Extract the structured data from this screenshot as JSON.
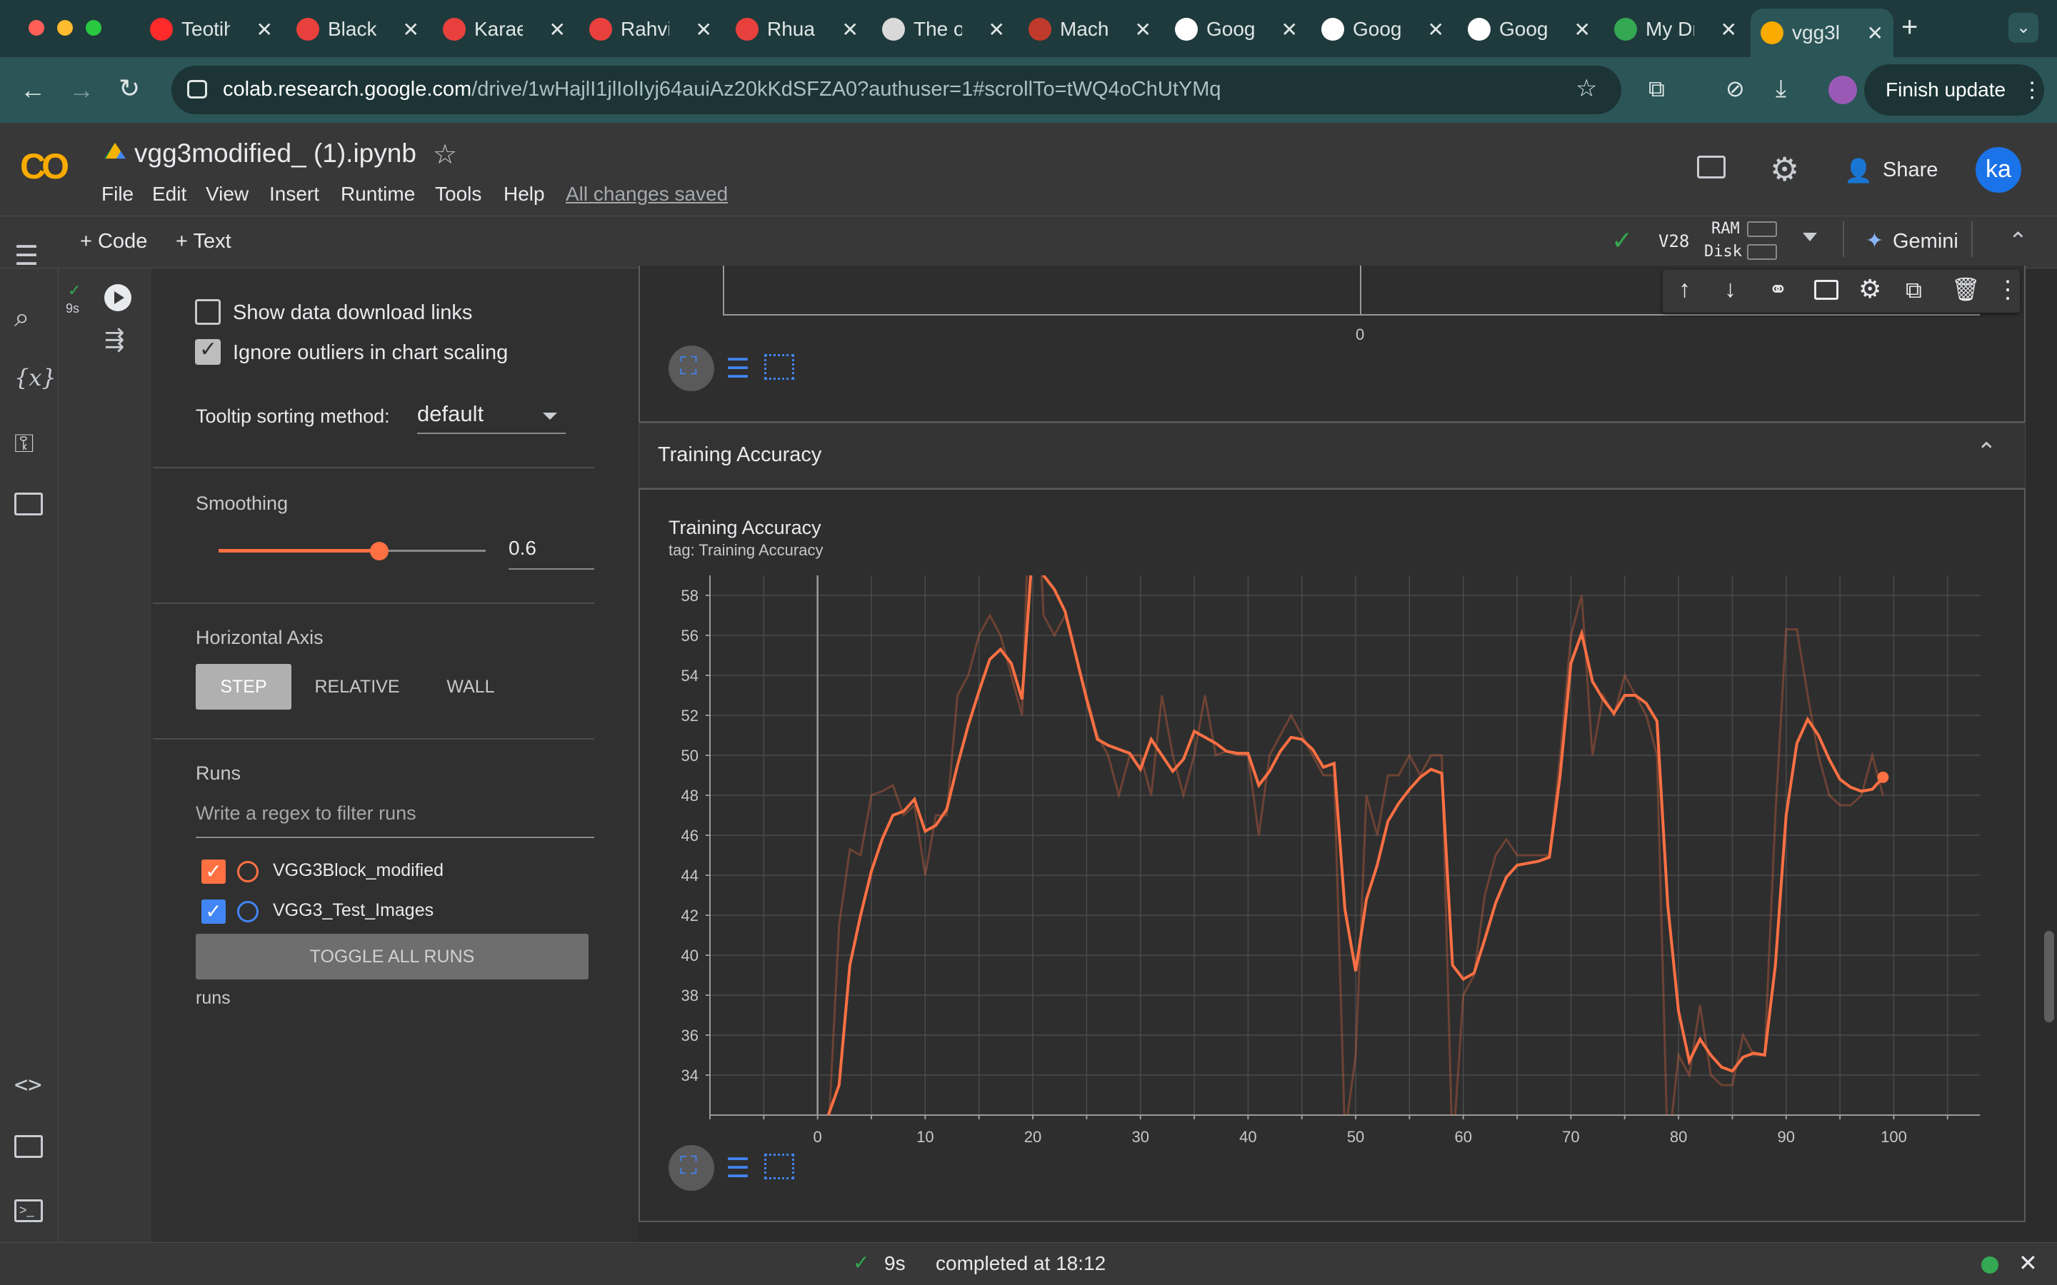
{
  "browser": {
    "tabs": [
      {
        "label": "Teotih",
        "color": "#ff2a2a"
      },
      {
        "label": "Black",
        "color": "#e8413d"
      },
      {
        "label": "Karae",
        "color": "#e8413d"
      },
      {
        "label": "Rahvi",
        "color": "#e8413d"
      },
      {
        "label": "Rhuar",
        "color": "#e8413d"
      },
      {
        "label": "The o",
        "color": "#d9d9d9"
      },
      {
        "label": "Machi",
        "color": "#c03a2b"
      },
      {
        "label": "Googl",
        "color": "#ffffff"
      },
      {
        "label": "Goog",
        "color": "#ffffff"
      },
      {
        "label": "Goog",
        "color": "#ffffff"
      },
      {
        "label": "My Dr",
        "color": "#34a853"
      },
      {
        "label": "vgg3l",
        "color": "#f9ab00"
      }
    ],
    "url_host": "colab.research.google.com",
    "url_path": "/drive/1wHajlI1jlIolIyj64auiAz20kKdSFZA0?authuser=1#scrollTo=tWQ4oChUtYMq",
    "finish_update": "Finish update"
  },
  "colab": {
    "logo": "CO",
    "notebook_title": "vgg3modified_ (1).ipynb",
    "menu": [
      "File",
      "Edit",
      "View",
      "Insert",
      "Runtime",
      "Tools",
      "Help"
    ],
    "save_status": "All changes saved",
    "share_label": "Share",
    "avatar": "ka",
    "add_code": "+ Code",
    "add_text": "+ Text",
    "runtime": "V28",
    "ram_label": "RAM",
    "disk_label": "Disk",
    "gemini_label": "Gemini",
    "cell_time": "9s"
  },
  "tensorboard": {
    "show_download_links": "Show data download links",
    "show_download_checked": false,
    "ignore_outliers": "Ignore outliers in chart scaling",
    "ignore_outliers_checked": true,
    "tooltip_sorting_label": "Tooltip sorting method:",
    "tooltip_sorting_value": "default",
    "smoothing_label": "Smoothing",
    "smoothing_value": "0.6",
    "horizontal_axis_label": "Horizontal Axis",
    "axis_options": [
      "STEP",
      "RELATIVE",
      "WALL"
    ],
    "axis_selected": "STEP",
    "runs_label": "Runs",
    "runs_filter_placeholder": "Write a regex to filter runs",
    "runs": [
      {
        "name": "VGG3Block_modified",
        "color": "#ff7043",
        "checked": true
      },
      {
        "name": "VGG3_Test_Images",
        "color": "#4285f4",
        "checked": true
      }
    ],
    "toggle_all": "TOGGLE ALL RUNS",
    "runs_footer": "runs",
    "section_title": "Training Accuracy",
    "upper_axis_zero": "0"
  },
  "status": {
    "duration": "9s",
    "completed": "completed at 18:12"
  },
  "chart_data": {
    "type": "line",
    "title": "Training Accuracy",
    "subtitle": "tag: Training Accuracy",
    "xlim": [
      -10,
      108
    ],
    "ylim": [
      32,
      59
    ],
    "x_ticks": [
      0,
      10,
      20,
      30,
      40,
      50,
      60,
      70,
      80,
      90,
      100
    ],
    "y_ticks": [
      34,
      36,
      38,
      40,
      42,
      44,
      46,
      48,
      50,
      52,
      54,
      56,
      58
    ],
    "series": [
      {
        "name": "VGG3Block_modified",
        "color": "#ff7043",
        "x": [
          1,
          2,
          3,
          4,
          5,
          6,
          7,
          8,
          9,
          10,
          11,
          12,
          13,
          14,
          15,
          16,
          17,
          18,
          19,
          20,
          21,
          22,
          23,
          24,
          25,
          26,
          27,
          28,
          29,
          30,
          31,
          32,
          33,
          34,
          35,
          36,
          37,
          38,
          39,
          40,
          41,
          42,
          43,
          44,
          45,
          46,
          47,
          48,
          49,
          50,
          51,
          52,
          53,
          54,
          55,
          56,
          57,
          58,
          59,
          60,
          61,
          62,
          63,
          64,
          65,
          66,
          67,
          68,
          69,
          70,
          71,
          72,
          73,
          74,
          75,
          76,
          77,
          78,
          79,
          80,
          81,
          82,
          83,
          84,
          85,
          86,
          87,
          88,
          89,
          90,
          91,
          92,
          93,
          94,
          95,
          96,
          97,
          98,
          99
        ],
        "raw": [
          31,
          41.5,
          45.3,
          45,
          48,
          48.2,
          48.5,
          47,
          47.5,
          44,
          47,
          47,
          53,
          54,
          56,
          57,
          56,
          54,
          52,
          68,
          57,
          56,
          57,
          55,
          53,
          51,
          50,
          48,
          50,
          50,
          48,
          53,
          50,
          48,
          50,
          53,
          50,
          50.2,
          50,
          50,
          46,
          50,
          51,
          52,
          51,
          50,
          49,
          49,
          31,
          35,
          48,
          46,
          49,
          49,
          50,
          49,
          50,
          50,
          30,
          38,
          39,
          43,
          45,
          45.8,
          45,
          45,
          45,
          45,
          50,
          56,
          58,
          50,
          53,
          52,
          54,
          53,
          52,
          50,
          30,
          35,
          34,
          37.5,
          34,
          33.5,
          33.5,
          36,
          35,
          35,
          47,
          56.3,
          56.3,
          53,
          50,
          48,
          47.5,
          47.5,
          48,
          50,
          48
        ],
        "smoothed": [
          32,
          33.5,
          39.5,
          42,
          44.2,
          45.8,
          47,
          47.2,
          47.8,
          46.2,
          46.5,
          47.3,
          49.5,
          51.5,
          53.2,
          54.8,
          55.3,
          54.6,
          52.8,
          60.5,
          59,
          58.3,
          57.2,
          55,
          52.8,
          50.8,
          50.5,
          50.3,
          50.1,
          49.3,
          50.8,
          50,
          49.2,
          49.8,
          51.2,
          50.9,
          50.6,
          50.2,
          50.1,
          50.1,
          48.5,
          49.2,
          50.2,
          50.9,
          50.8,
          50.3,
          49.4,
          49.6,
          42.3,
          39.2,
          42.8,
          44.5,
          46.7,
          47.6,
          48.3,
          48.9,
          49.3,
          49.1,
          39.5,
          38.8,
          39.1,
          40.8,
          42.6,
          43.9,
          44.5,
          44.6,
          44.7,
          44.9,
          49,
          54.6,
          56.1,
          53.7,
          52.8,
          52.1,
          53,
          53,
          52.6,
          51.7,
          42.5,
          37.2,
          34.7,
          35.8,
          35,
          34.4,
          34.2,
          34.9,
          35.1,
          35,
          39.5,
          47,
          50.6,
          51.8,
          51,
          49.8,
          48.8,
          48.4,
          48.2,
          48.3,
          48.9
        ]
      }
    ]
  }
}
